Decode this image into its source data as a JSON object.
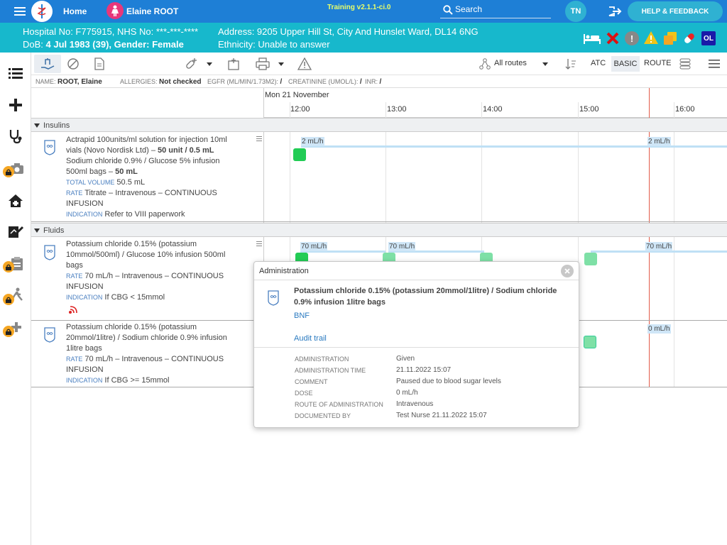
{
  "topbar": {
    "home_label": "Home",
    "patient_name": "Elaine ROOT",
    "training_label": "Training v2.1.1-ci.0",
    "search_label": "Search",
    "user_initials": "TN",
    "help_label": "HELP & FEEDBACK"
  },
  "patient": {
    "hospital_no": "Hospital No: F775915, NHS No: ***-***-****",
    "dob_prefix": "DoB: ",
    "dob_value": "4 Jul 1983 (39), Gender: Female",
    "address": "Address: 9205 Upper Hill St, City And Hunslet Ward, DL14 6NG",
    "ethnicity": "Ethnicity: Unable to answer",
    "badge": "OL"
  },
  "toolbar": {
    "routes_label": "All routes",
    "atc_label": "ATC",
    "basic_label": "BASIC",
    "route_label": "ROUTE"
  },
  "infoline": {
    "name_key": "NAME:",
    "name_val": "ROOT, Elaine",
    "allergies_key": "ALLERGIES:",
    "allergies_val": "Not checked",
    "egfr_key": "EGFR (ML/MIN/1.73M2):",
    "egfr_val": "/",
    "creat_key": "CREATININE (UMOL/L):",
    "creat_val": "/",
    "inr_key": "INR:",
    "inr_val": "/"
  },
  "timeline": {
    "date": "Mon 21 November",
    "hours": [
      "12:00",
      "13:00",
      "14:00",
      "15:00",
      "16:00"
    ]
  },
  "sections": {
    "insulins": "Insulins",
    "fluids": "Fluids"
  },
  "rows": [
    {
      "line1": "Actrapid 100units/ml solution for injection 10ml",
      "line2a": "vials (Novo Nordisk Ltd) – ",
      "line2b": "50 unit / 0.5 mL",
      "line3": "Sodium chloride 0.9% / Glucose 5% infusion",
      "line4a": "500ml bags – ",
      "line4b": "50 mL",
      "tv_label": "TOTAL VOLUME",
      "tv_value": "50.5 mL",
      "rate_label": "RATE",
      "rate_value": "Titrate – Intravenous – CONTINUOUS",
      "rate_value2": "INFUSION",
      "ind_label": "INDICATION",
      "ind_value": "Refer to VIII paperwork",
      "bar_labels": [
        "2 mL/h",
        "2 mL/h"
      ]
    },
    {
      "line1": "Potassium chloride 0.15% (potassium",
      "line2": "10mmol/500ml) / Glucose 10% infusion 500ml",
      "line3": "bags",
      "rate_label": "RATE",
      "rate_value": "70 mL/h – Intravenous – CONTINUOUS",
      "rate_value2": "INFUSION",
      "ind_label": "INDICATION",
      "ind_value": "If CBG < 15mmol",
      "bar_labels": [
        "70 mL/h",
        "70 mL/h",
        "70 mL/h"
      ]
    },
    {
      "line1": "Potassium chloride 0.15% (potassium",
      "line2": "20mmol/1litre) / Sodium chloride 0.9% infusion",
      "line3": "1litre bags",
      "rate_label": "RATE",
      "rate_value": "70 mL/h – Intravenous – CONTINUOUS",
      "rate_value2": "INFUSION",
      "ind_label": "INDICATION",
      "ind_value": "If CBG >= 15mmol",
      "bar_labels": [
        "0 mL/h"
      ]
    }
  ],
  "popup": {
    "title": "Administration",
    "drug_line1": "Potassium chloride 0.15% (potassium 20mmol/1litre) / Sodium chloride",
    "drug_line2": "0.9% infusion 1litre bags",
    "bnf_link": "BNF",
    "audit_link": "Audit trail",
    "fields": [
      {
        "key": "ADMINISTRATION",
        "value": "Given"
      },
      {
        "key": "ADMINISTRATION TIME",
        "value": "21.11.2022 15:07"
      },
      {
        "key": "COMMENT",
        "value": "Paused due to blood sugar levels"
      },
      {
        "key": "DOSE",
        "value": "0 mL/h"
      },
      {
        "key": "ROUTE OF ADMINISTRATION",
        "value": "Intravenous"
      },
      {
        "key": "DOCUMENTED BY",
        "value": "Test Nurse 21.11.2022 15:07"
      }
    ]
  },
  "colors": {
    "topbar": "#1e7fd6",
    "patient_bar": "#17b8cc",
    "admin_green": "#22cc55",
    "admin_light_green": "#7ee0a6",
    "now_line": "#e25c4a"
  }
}
